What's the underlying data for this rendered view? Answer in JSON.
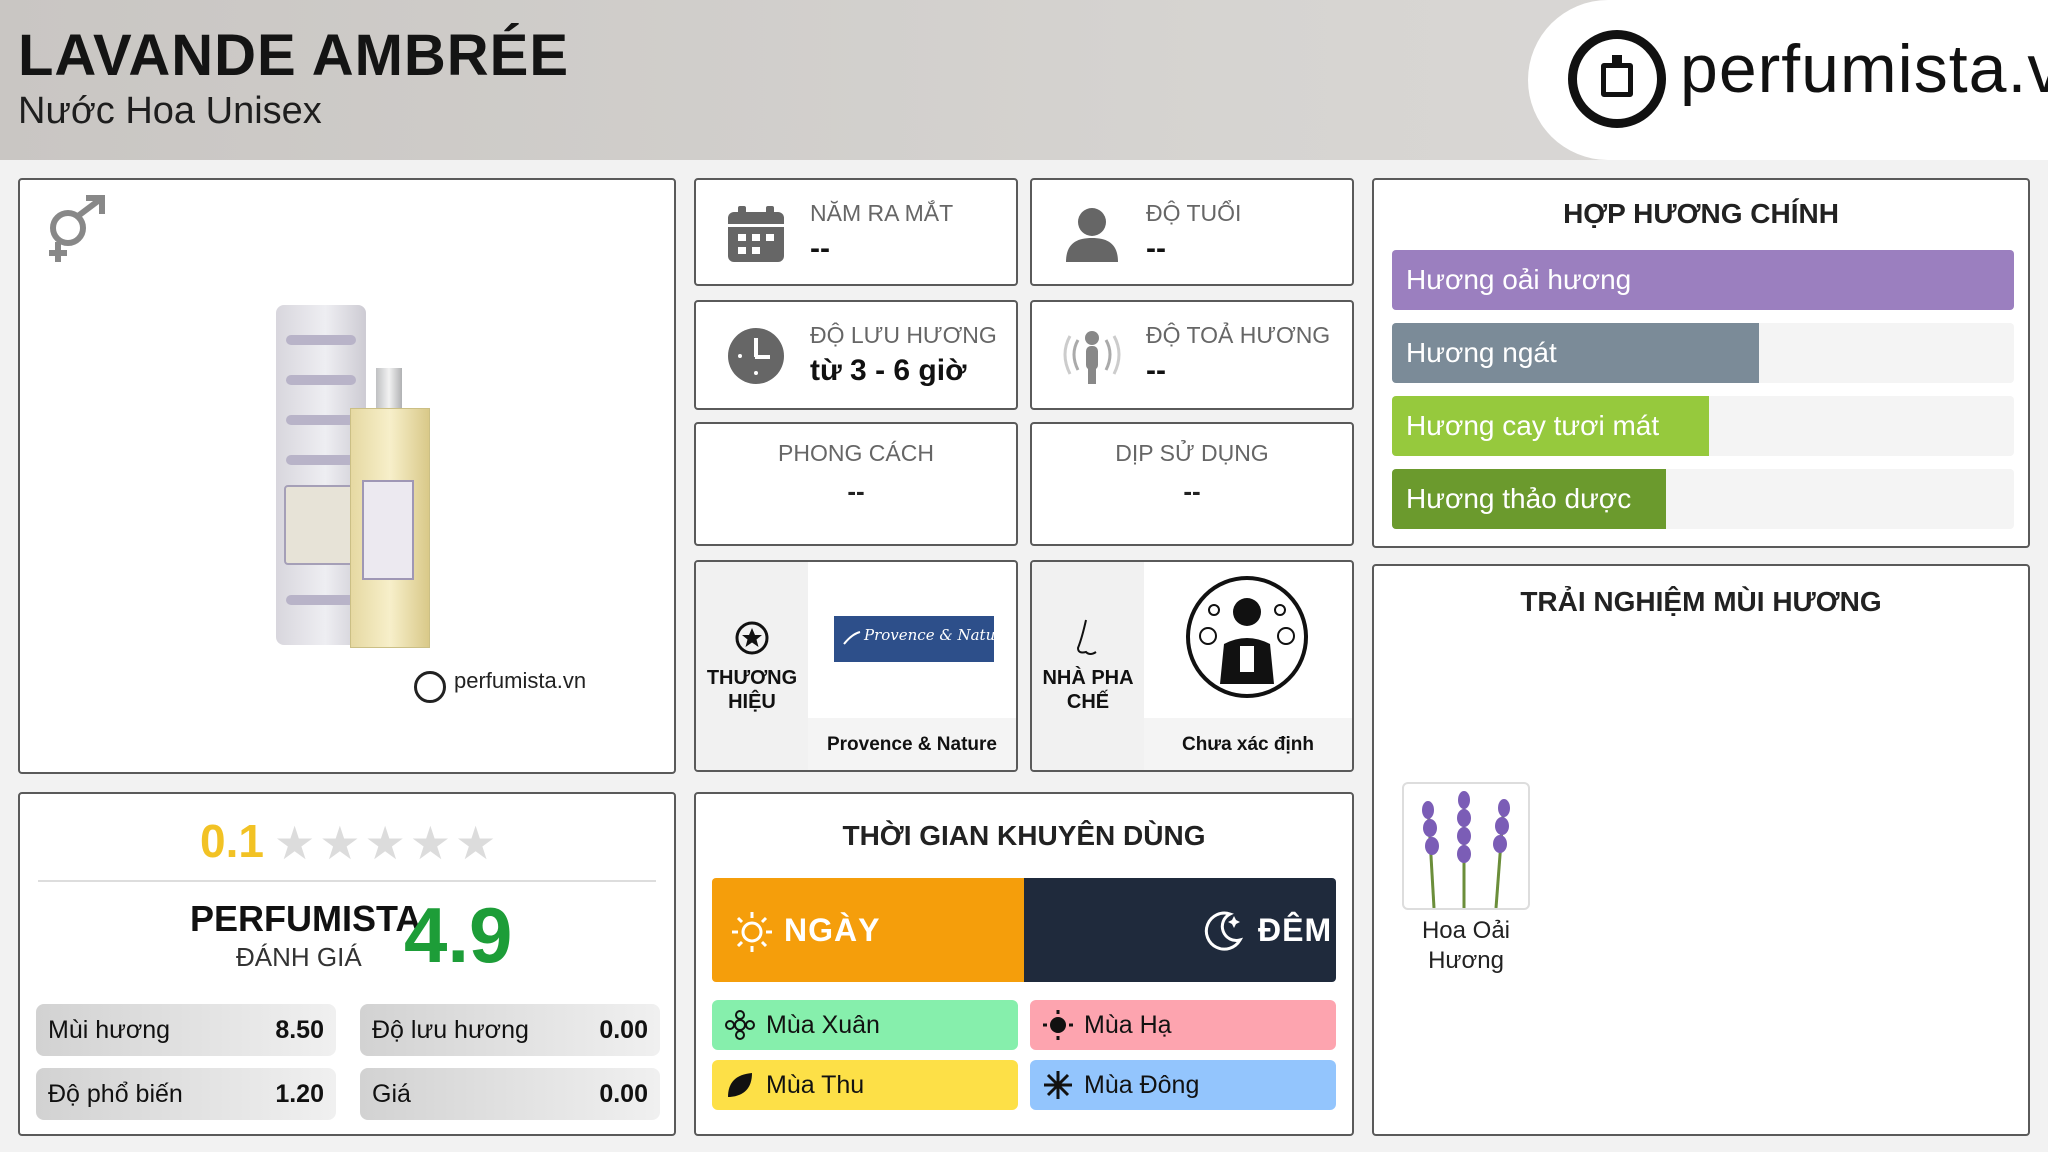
{
  "header": {
    "title": "LAVANDE AMBRÉE",
    "subtitle": "Nước Hoa Unisex",
    "logo_text": "perfumista.vn"
  },
  "product": {
    "image_logo_text": "perfumista.vn",
    "gender_icon": "unisex-gender-icon"
  },
  "info": {
    "release_year": {
      "label": "NĂM RA MẮT",
      "value": "--"
    },
    "age": {
      "label": "ĐỘ TUỔI",
      "value": "--"
    },
    "longevity": {
      "label": "ĐỘ LƯU HƯƠNG",
      "value": "từ 3 - 6 giờ"
    },
    "sillage": {
      "label": "ĐỘ TOẢ HƯƠNG",
      "value": "--"
    },
    "style": {
      "label": "PHONG CÁCH",
      "value": "--"
    },
    "occasion": {
      "label": "DỊP SỬ DỤNG",
      "value": "--"
    },
    "brand": {
      "label_line1": "THƯƠNG",
      "label_line2": "HIỆU",
      "name": "Provence & Nature",
      "logo_text": "Provence & Nature"
    },
    "perfumer": {
      "label_line1": "NHÀ PHA",
      "label_line2": "CHẾ",
      "name": "Chưa xác định"
    }
  },
  "accords": {
    "title": "HỢP HƯƠNG CHÍNH",
    "items": [
      {
        "label": "Hương oải hương",
        "level": 1.0,
        "color": "#9b7fbf"
      },
      {
        "label": "Hương ngát",
        "level": 0.59,
        "color": "#7b8b98"
      },
      {
        "label": "Hương cay tươi mát",
        "level": 0.51,
        "color": "#96c93d"
      },
      {
        "label": "Hương thảo dược",
        "level": 0.44,
        "color": "#6b9a2d"
      }
    ]
  },
  "rating": {
    "user_score": "0.1",
    "user_stars": 0.1,
    "perfumista_label": "PERFUMISTA",
    "perfumista_sub": "ĐÁNH GIÁ",
    "perfumista_score": "4.9",
    "metrics": [
      {
        "label": "Mùi hương",
        "value": "8.50"
      },
      {
        "label": "Độ lưu hương",
        "value": "0.00"
      },
      {
        "label": "Độ phổ biến",
        "value": "1.20"
      },
      {
        "label": "Giá",
        "value": "0.00"
      }
    ]
  },
  "time": {
    "title": "THỜI GIAN KHUYÊN DÙNG",
    "day": "NGÀY",
    "night": "ĐÊM",
    "seasons": [
      {
        "label": "Mùa Xuân",
        "color": "#86efac",
        "icon": "flower-icon"
      },
      {
        "label": "Mùa Hạ",
        "color": "#fda4af",
        "icon": "sun-icon"
      },
      {
        "label": "Mùa Thu",
        "color": "#fde047",
        "icon": "leaf-icon"
      },
      {
        "label": "Mùa Đông",
        "color": "#93c5fd",
        "icon": "snowflake-icon"
      }
    ]
  },
  "experience": {
    "title": "TRẢI NGHIỆM MÙI HƯƠNG",
    "notes": [
      {
        "name_line1": "Hoa Oải",
        "name_line2": "Hương"
      }
    ]
  }
}
